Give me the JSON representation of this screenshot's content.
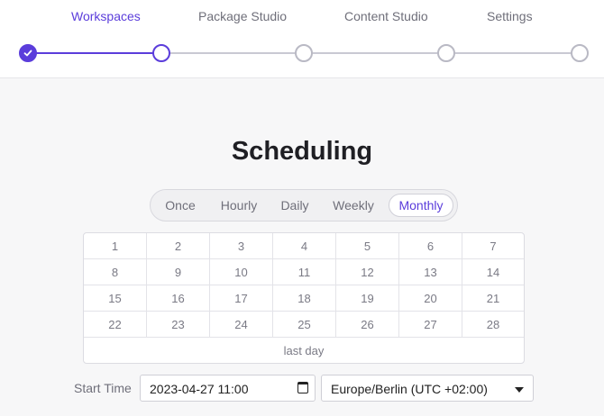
{
  "nav": {
    "tabs": [
      {
        "label": "Workspaces",
        "active": true
      },
      {
        "label": "Package Studio",
        "active": false
      },
      {
        "label": "Content Studio",
        "active": false
      },
      {
        "label": "Settings",
        "active": false
      }
    ]
  },
  "stepper": {
    "steps": [
      {
        "state": "done",
        "icon": "check-icon"
      },
      {
        "state": "current"
      },
      {
        "state": "upcoming"
      },
      {
        "state": "upcoming"
      },
      {
        "state": "upcoming"
      }
    ]
  },
  "page": {
    "title": "Scheduling"
  },
  "frequency": {
    "options": [
      "Once",
      "Hourly",
      "Daily",
      "Weekly",
      "Monthly"
    ],
    "selected": "Monthly"
  },
  "month_days": {
    "days": [
      "1",
      "2",
      "3",
      "4",
      "5",
      "6",
      "7",
      "8",
      "9",
      "10",
      "11",
      "12",
      "13",
      "14",
      "15",
      "16",
      "17",
      "18",
      "19",
      "20",
      "21",
      "22",
      "23",
      "24",
      "25",
      "26",
      "27",
      "28"
    ],
    "last_day_label": "last day"
  },
  "start_time": {
    "label": "Start Time",
    "value": "2023-04-27 11:00",
    "timezone": "Europe/Berlin (UTC +02:00)"
  },
  "colors": {
    "accent": "#5b3ddb",
    "inactive": "#b9b9c4"
  }
}
